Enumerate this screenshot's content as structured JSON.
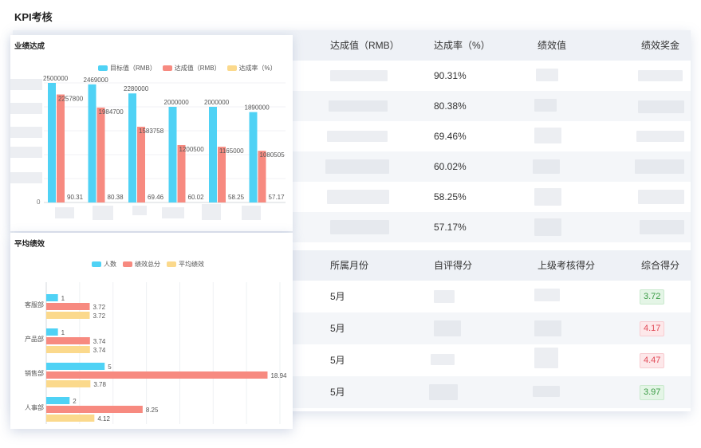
{
  "page": {
    "title": "KPI考核"
  },
  "table1": {
    "headers": [
      "达成值（RMB）",
      "达成率（%）",
      "绩效值",
      "绩效奖金"
    ],
    "rates": [
      "90.31%",
      "80.38%",
      "69.46%",
      "60.02%",
      "58.25%",
      "57.17%"
    ]
  },
  "table2": {
    "headers": [
      "所属月份",
      "自评得分",
      "上级考核得分",
      "综合得分"
    ],
    "rows": [
      {
        "month": "5月",
        "score": "3.72",
        "status": "green"
      },
      {
        "month": "5月",
        "score": "4.17",
        "status": "red"
      },
      {
        "month": "5月",
        "score": "4.47",
        "status": "red"
      },
      {
        "month": "5月",
        "score": "3.97",
        "status": "green"
      }
    ]
  },
  "chart_data": [
    {
      "type": "bar",
      "title": "业绩达成",
      "legend": [
        "目标值（RMB）",
        "达成值（RMB）",
        "达成率（%）"
      ],
      "legend_position": "top-right",
      "y_tick": "0",
      "series": [
        {
          "name": "目标值（RMB）",
          "color": "#4fd2f5",
          "values": [
            2500000,
            2469000,
            2280000,
            2000000,
            2000000,
            1890000
          ]
        },
        {
          "name": "达成值（RMB）",
          "color": "#f78a80",
          "values": [
            2257800,
            1984700,
            1583758,
            1200500,
            1165000,
            1080505
          ]
        },
        {
          "name": "达成率（%）",
          "color": "#fbd98c",
          "values": [
            90.31,
            80.38,
            69.46,
            60.02,
            58.25,
            57.17
          ]
        }
      ],
      "ylim": [
        0,
        2500000
      ]
    },
    {
      "type": "bar",
      "orientation": "horizontal",
      "title": "平均绩效",
      "legend": [
        "人数",
        "绩效总分",
        "平均绩效"
      ],
      "legend_position": "top-center",
      "categories": [
        "客服部",
        "产品部",
        "销售部",
        "人事部"
      ],
      "series": [
        {
          "name": "人数",
          "color": "#4fd2f5",
          "values": [
            1,
            1,
            5,
            2
          ]
        },
        {
          "name": "绩效总分",
          "color": "#f78a80",
          "values": [
            3.72,
            3.74,
            18.94,
            8.25
          ]
        },
        {
          "name": "平均绩效",
          "color": "#fbd98c",
          "values": [
            3.72,
            3.74,
            3.78,
            4.12
          ]
        }
      ],
      "xlim": [
        0,
        20
      ]
    }
  ]
}
